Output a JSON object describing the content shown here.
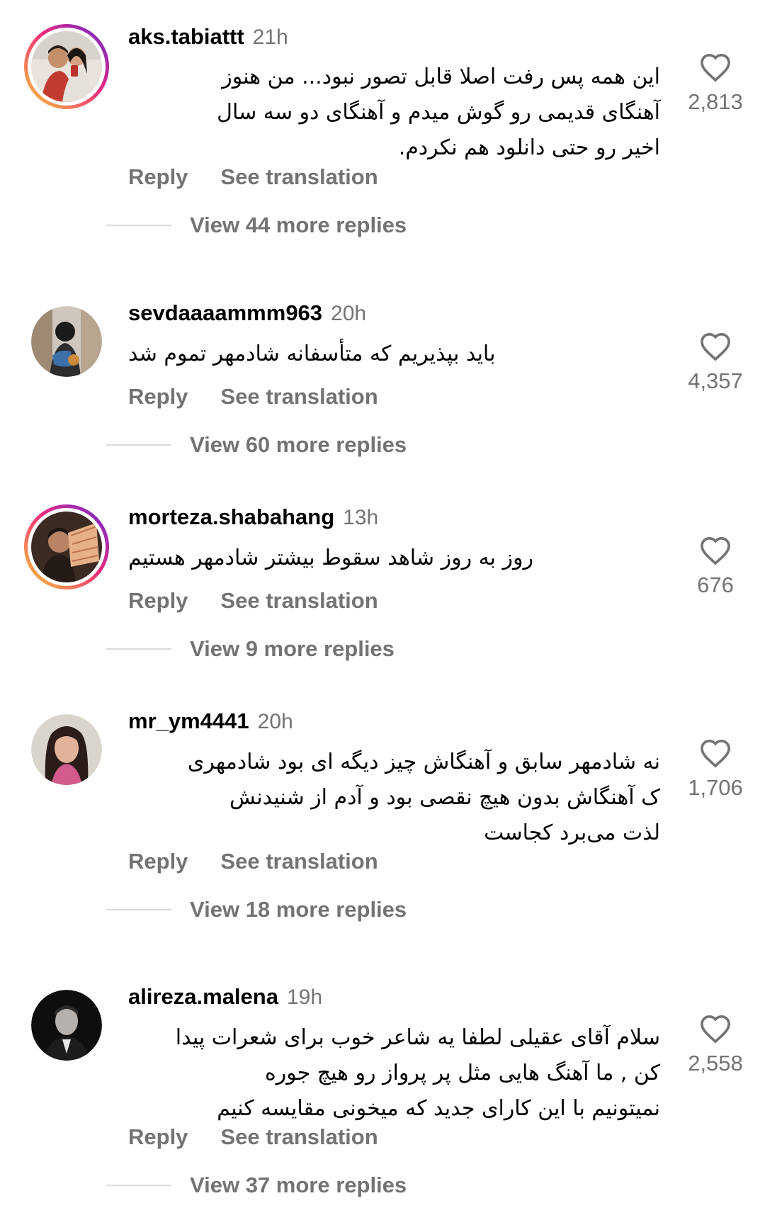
{
  "comments": [
    {
      "username": "aks.tabiattt",
      "time": "21h",
      "text_lines": [
        "این همه پس رفت اصلا قابل تصور نبود... من هنوز",
        "آهنگای قدیمی رو گوش میدم و آهنگای دو سه سال",
        "اخیر رو حتی دانلود هم نکردم."
      ],
      "reply_label": "Reply",
      "translate_label": "See translation",
      "view_more": "View 44 more replies",
      "likes": "2,813",
      "has_story": true
    },
    {
      "username": "sevdaaaammm963",
      "time": "20h",
      "text_lines": [
        "باید بپذیریم که متأسفانه شادمهر تموم شد"
      ],
      "reply_label": "Reply",
      "translate_label": "See translation",
      "view_more": "View 60 more replies",
      "likes": "4,357",
      "has_story": false
    },
    {
      "username": "morteza.shabahang",
      "time": "13h",
      "text_lines": [
        "روز به روز شاهد سقوط بیشتر شادمهر هستیم"
      ],
      "reply_label": "Reply",
      "translate_label": "See translation",
      "view_more": "View 9 more replies",
      "likes": "676",
      "has_story": true
    },
    {
      "username": "mr_ym4441",
      "time": "20h",
      "text_lines": [
        "نه شادمهر سابق و آهنگاش چیز دیگه ای بود شادمهری",
        "ک آهنگاش بدون هیچ نقصی بود و آدم از شنیدنش",
        "لذت می‌برد کجاست"
      ],
      "reply_label": "Reply",
      "translate_label": "See translation",
      "view_more": "View 18 more replies",
      "likes": "1,706",
      "has_story": false
    },
    {
      "username": "alireza.malena",
      "time": "19h",
      "text_lines": [
        "سلام آقای عقیلی لطفا یه شاعر خوب برای شعرات پیدا",
        "کن , ما آهنگ هایی مثل پر پرواز رو هیچ جوره",
        "نمیتونیم با این کارای جدید که میخونی مقایسه کنیم"
      ],
      "reply_label": "Reply",
      "translate_label": "See translation",
      "view_more": "View 37 more replies",
      "likes": "2,558",
      "has_story": false
    }
  ],
  "icons": {
    "like": "heart-outline-icon"
  },
  "colors": {
    "secondary_text": "#737373",
    "divider": "#dbdbdb",
    "story_ring_start": "#f9ce34",
    "story_ring_end": "#6228d7"
  }
}
